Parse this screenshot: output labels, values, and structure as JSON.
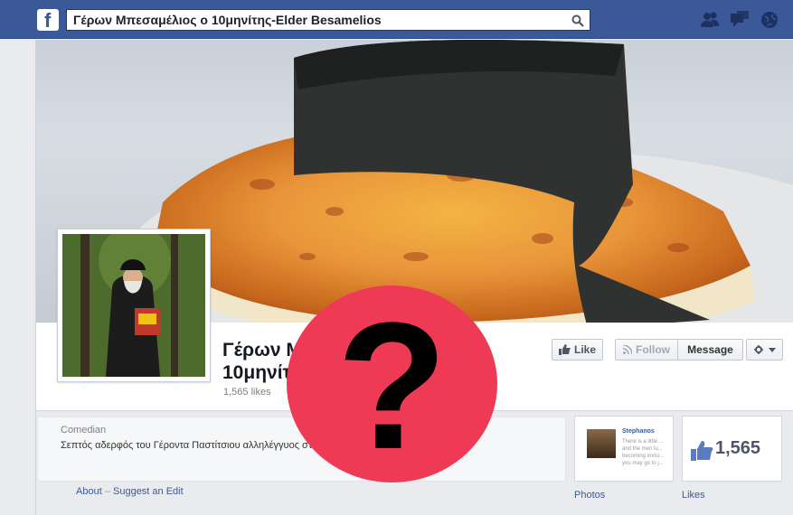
{
  "search": {
    "value": "Γέρων Μπεσαμέλιος ο 10μηνίτης-Elder Besamelios"
  },
  "page": {
    "name_line1": "Γέρων Μ",
    "name_line2": "10μηνίτ",
    "likes_text": "1,565 likes"
  },
  "actions": {
    "like_label": "Like",
    "follow_label": "Follow",
    "message_label": "Message"
  },
  "info": {
    "category": "Comedian",
    "description": "Σεπτός αδερφός του Γέροντα Παστίτσιου αλληλέγγυος στ                                          μέλ."
  },
  "footer_links": {
    "about": "About",
    "separator": "–",
    "suggest_edit": "Suggest an Edit"
  },
  "photos_tile": {
    "post_author": "Stephanos",
    "post_snippet": "There is a little ... and the men lu... becoming invisi... you may go to j...",
    "label": "Photos"
  },
  "likes_tile": {
    "count": "1,565",
    "label": "Likes"
  },
  "overlay": {
    "symbol": "?"
  },
  "colors": {
    "topbar": "#3b5998",
    "overlay_circle": "#ee3a55",
    "link": "#3b5998"
  }
}
